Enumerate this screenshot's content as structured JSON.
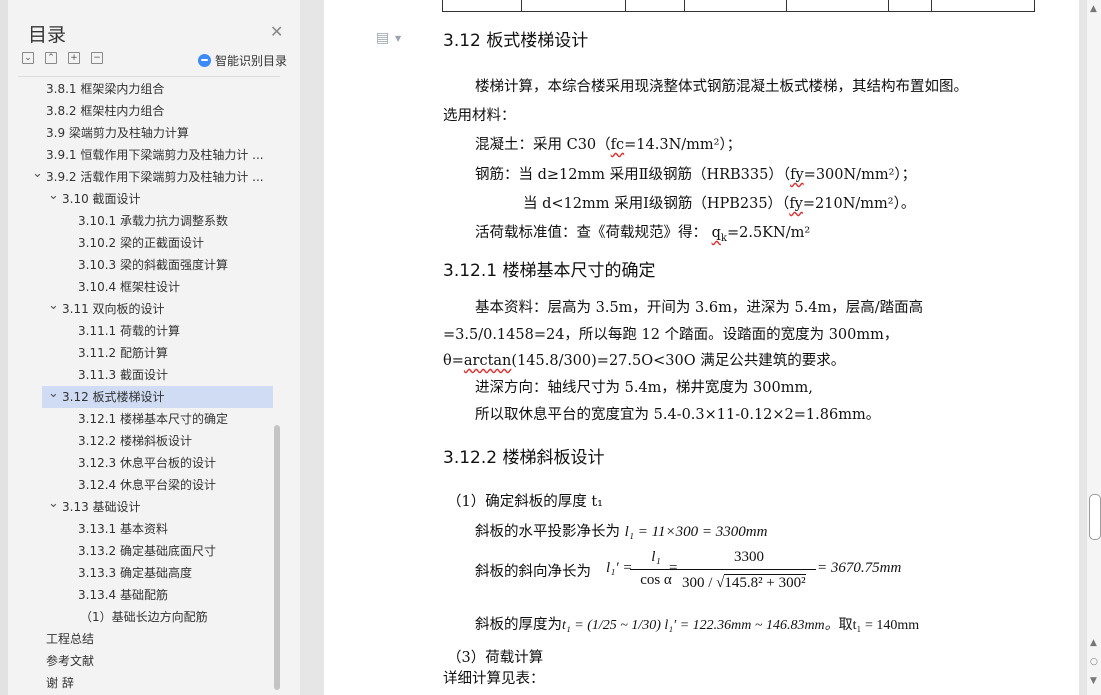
{
  "nav": {
    "title": "目录",
    "close_icon": "close-icon",
    "smart_label": "智能识别目录",
    "toolbar_icons": [
      "collapse-all-icon",
      "expand-all-icon",
      "add-heading-icon",
      "remove-heading-icon"
    ],
    "items": [
      {
        "label": "3.8.1 框架梁内力组合",
        "level": 1,
        "expander": false
      },
      {
        "label": "3.8.2 框架柱内力组合",
        "level": 1,
        "expander": false
      },
      {
        "label": "3.9  梁端剪力及柱轴力计算",
        "level": 1,
        "expander": false
      },
      {
        "label": "3.9.1  恒载作用下梁端剪力及柱轴力计 ...",
        "level": 1,
        "expander": false
      },
      {
        "label": "3.9.2  活载作用下梁端剪力及柱轴力计 ...",
        "level": 1,
        "expander": true
      },
      {
        "label": "3.10  截面设计",
        "level": 2,
        "expander": true
      },
      {
        "label": "3.10.1  承载力抗力调整系数",
        "level": 3,
        "expander": false
      },
      {
        "label": "3.10.2  梁的正截面设计",
        "level": 3,
        "expander": false
      },
      {
        "label": "3.10.3 梁的斜截面强度计算",
        "level": 3,
        "expander": false
      },
      {
        "label": "3.10.4 框架柱设计",
        "level": 3,
        "expander": false
      },
      {
        "label": "3.11  双向板的设计",
        "level": 2,
        "expander": true
      },
      {
        "label": "3.11.1 荷载的计算",
        "level": 3,
        "expander": false
      },
      {
        "label": "3.11.2 配筋计算",
        "level": 3,
        "expander": false
      },
      {
        "label": "3.11.3 截面设计",
        "level": 3,
        "expander": false
      },
      {
        "label": "3.12 板式楼梯设计",
        "level": 2,
        "expander": true,
        "selected": true
      },
      {
        "label": "3.12.1 楼梯基本尺寸的确定",
        "level": 3,
        "expander": false
      },
      {
        "label": "3.12.2 楼梯斜板设计",
        "level": 3,
        "expander": false
      },
      {
        "label": "3.12.3 休息平台板的设计",
        "level": 3,
        "expander": false
      },
      {
        "label": "3.12.4 休息平台梁的设计",
        "level": 3,
        "expander": false
      },
      {
        "label": "3.13 基础设计",
        "level": 2,
        "expander": true
      },
      {
        "label": "3.13.1  基本资料",
        "level": 3,
        "expander": false
      },
      {
        "label": "3.13.2  确定基础底面尺寸",
        "level": 3,
        "expander": false
      },
      {
        "label": "3.13.3  确定基础高度",
        "level": 3,
        "expander": false
      },
      {
        "label": "3.13.4  基础配筋",
        "level": 3,
        "expander": false
      },
      {
        "label": "（1）基础长边方向配筋",
        "level": 4,
        "expander": false
      },
      {
        "label": "工程总结",
        "level": 1,
        "expander": false
      },
      {
        "label": "参考文献",
        "level": 1,
        "expander": false
      },
      {
        "label": "谢  辞",
        "level": 1,
        "expander": false
      }
    ]
  },
  "doc": {
    "h312": "3.12 板式楼梯设计",
    "p1": "楼梯计算，本综合楼采用现浇整体式钢筋混凝土板式楼梯，其结构布置如图。",
    "p1b": "选用材料：",
    "concrete": {
      "a": "混凝土：采用 C30（",
      "b": "fc",
      "c": "=14.3N/mm²）；"
    },
    "steel1": {
      "a": "钢筋：当  d≥12mm    采用Ⅱ级钢筋（HRB335）（",
      "b": "fy",
      "c": "=300N/mm²）；"
    },
    "steel2": {
      "a": "当  d<12mm    采用Ⅰ级钢筋（HPB235）（",
      "b": "fy",
      "c": "=210N/mm²）。"
    },
    "live": {
      "a": "活荷载标准值：查《荷载规范》得：  ",
      "b": "q",
      "sub": "k",
      "c": "=2.5KN/m²"
    },
    "h3121": "3.12.1 楼梯基本尺寸的确定",
    "b1": "基本资料：层高为 3.5m，开间为 3.6m，进深为 5.4m，层高/踏面高",
    "b2": "=3.5/0.1458=24，所以每跑 12 个踏面。设踏面的宽度为 300mm，",
    "b3": {
      "a": "θ=",
      "b": "arctan",
      "c": "(145.8/300)=27.5O<30O 满足公共建筑的要求。"
    },
    "b4": "进深方向：轴线尺寸为 5.4m，梯井宽度为 300mm,",
    "b5": "所以取休息平台的宽度宜为 5.4-0.3×11-0.12×2=1.86mm。",
    "h3122": "3.12.2 楼梯斜板设计",
    "s1": "（1）确定斜板的厚度 t₁",
    "s2a": "斜板的水平投影净长为",
    "s2m": "l₁ = 11×300 = 3300mm",
    "s3a": "斜板的斜向净长为",
    "s3lhs": "l₁′ =",
    "s3num1": "l₁",
    "s3den1": "cos α",
    "s3num2": "3300",
    "s3den2a": "300 / √",
    "s3den2b": "145.8² + 300²",
    "s3res": "= 3670.75mm",
    "s4a": "斜板的厚度为",
    "s4m": "t₁ = (1/25 ~ 1/30) l₁′ = 122.36mm ~ 146.83mm。",
    "s4b": "取t₁ = 140mm",
    "s5": "（3）荷载计算",
    "s6": "详细计算见表："
  }
}
